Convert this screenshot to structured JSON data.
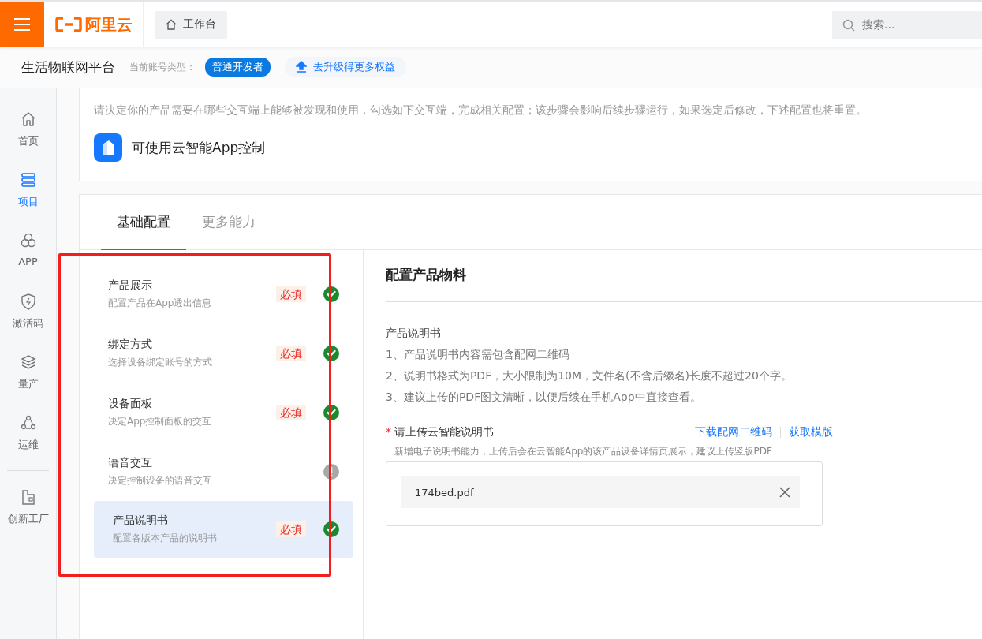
{
  "topbar": {
    "logo": "阿里云",
    "workbench": "工作台",
    "search": {
      "placeholder": "搜索..."
    }
  },
  "subbar": {
    "title": "生活物联网平台",
    "account_label": "当前账号类型：",
    "account_type": "普通开发者",
    "upgrade": "去升级得更多权益"
  },
  "sidebar": {
    "items": [
      {
        "label": "首页",
        "selected": false
      },
      {
        "label": "项目",
        "selected": true
      },
      {
        "label": "APP",
        "selected": false
      },
      {
        "label": "激活码",
        "selected": false
      },
      {
        "label": "量产",
        "selected": false
      },
      {
        "label": "运维",
        "selected": false
      },
      {
        "label": "创新工厂",
        "selected": false
      }
    ]
  },
  "intro": {
    "text": "请决定你的产品需要在哪些交互端上能够被发现和使用，勾选如下交互端，完成相关配置；该步骤会影响后续步骤运行，如果选定后修改，下述配置也将重置。",
    "app_option": "可使用云智能App控制"
  },
  "tabs": [
    {
      "label": "基础配置",
      "selected": true
    },
    {
      "label": "更多能力",
      "selected": false
    }
  ],
  "steps": [
    {
      "title": "产品展示",
      "desc": "配置产品在App透出信息",
      "badge": "必填",
      "complete": true,
      "selected": false
    },
    {
      "title": "绑定方式",
      "desc": "选择设备绑定账号的方式",
      "badge": "必填",
      "complete": true,
      "selected": false
    },
    {
      "title": "设备面板",
      "desc": "决定App控制面板的交互",
      "badge": "必填",
      "complete": true,
      "selected": false
    },
    {
      "title": "语音交互",
      "desc": "决定控制设备的语音交互",
      "complete": false,
      "selected": false
    },
    {
      "title": "产品说明书",
      "desc": "配置各版本产品的说明书",
      "badge": "必填",
      "complete": true,
      "selected": true
    }
  ],
  "panel": {
    "title": "配置产品物料",
    "section_title": "产品说明书",
    "notes": [
      "1、产品说明书内容需包含配网二维码",
      "2、说明书格式为PDF，大小限制为10M，文件名(不含后缀名)长度不超过20个字。",
      "3、建议上传的PDF图文清晰，以便后续在手机App中直接查看。"
    ],
    "upload": {
      "required_mark": "*",
      "label": "请上传云智能说明书",
      "links": [
        "下载配网二维码",
        "获取模版"
      ],
      "hint": "新增电子说明书能力，上传后会在云智能App的该产品设备详情页展示，建议上传竖版PDF",
      "files": [
        "174bed.pdf"
      ]
    }
  }
}
